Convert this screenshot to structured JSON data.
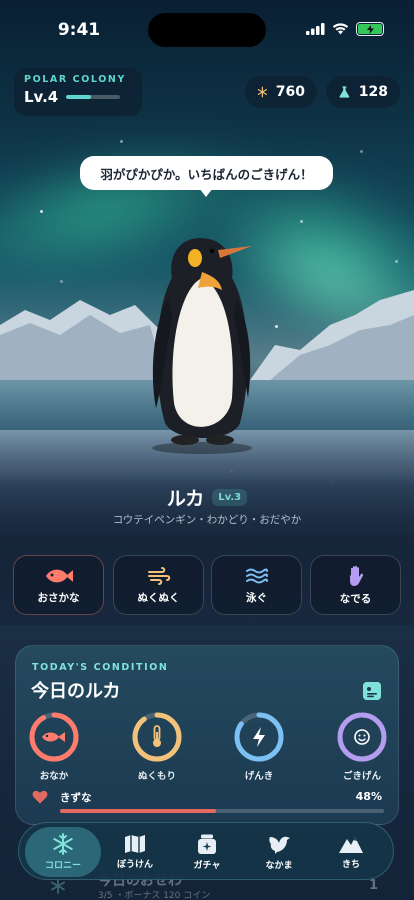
{
  "status_bar": {
    "time": "9:41"
  },
  "colony": {
    "label": "POLAR COLONY",
    "level": "Lv.4",
    "xp_progress": 0.45
  },
  "resources": {
    "snowflakes": "760",
    "potions": "128"
  },
  "speech_bubble": "羽がぴかぴか。いちばんのごきげん！",
  "pet": {
    "name": "ルカ",
    "level": "Lv.3",
    "description": "コウテイペンギン・わかどり・おだやか"
  },
  "actions": [
    {
      "label": "おさかな",
      "icon": "fish-icon",
      "color": "#ff7b6b"
    },
    {
      "label": "ぬくぬく",
      "icon": "wind-icon",
      "color": "#f2c27a"
    },
    {
      "label": "泳ぐ",
      "icon": "waves-icon",
      "color": "#7cc0f5"
    },
    {
      "label": "なでる",
      "icon": "hand-icon",
      "color": "#b49cf0"
    }
  ],
  "condition": {
    "eyebrow": "TODAY'S CONDITION",
    "title": "今日のルカ",
    "stats": [
      {
        "label": "おなか",
        "icon": "fish-icon",
        "color": "#ff7b6b",
        "value": 0.92
      },
      {
        "label": "ぬくもり",
        "icon": "thermometer-icon",
        "color": "#f2c27a",
        "value": 0.9
      },
      {
        "label": "げんき",
        "icon": "bolt-icon",
        "color": "#7cc0f5",
        "value": 0.85
      },
      {
        "label": "ごきげん",
        "icon": "smile-icon",
        "color": "#b49cf0",
        "value": 0.98
      }
    ],
    "bond": {
      "label": "きずな",
      "percent": "48%",
      "value": 0.48
    }
  },
  "next_card": {
    "title": "今日のおせわ",
    "subtitle": "3/5 ・ボーナス 120 コイン",
    "count": "1"
  },
  "tabs": [
    {
      "label": "コロニー",
      "icon": "snowflake-icon",
      "active": true
    },
    {
      "label": "ぼうけん",
      "icon": "map-icon",
      "active": false
    },
    {
      "label": "ガチャ",
      "icon": "gift-icon",
      "active": false
    },
    {
      "label": "なかま",
      "icon": "bird-icon",
      "active": false
    },
    {
      "label": "きち",
      "icon": "mountain-icon",
      "active": false
    }
  ],
  "colors": {
    "accent": "#7fe3db",
    "bond": "#e26a62",
    "background": "#0b1a2e"
  }
}
